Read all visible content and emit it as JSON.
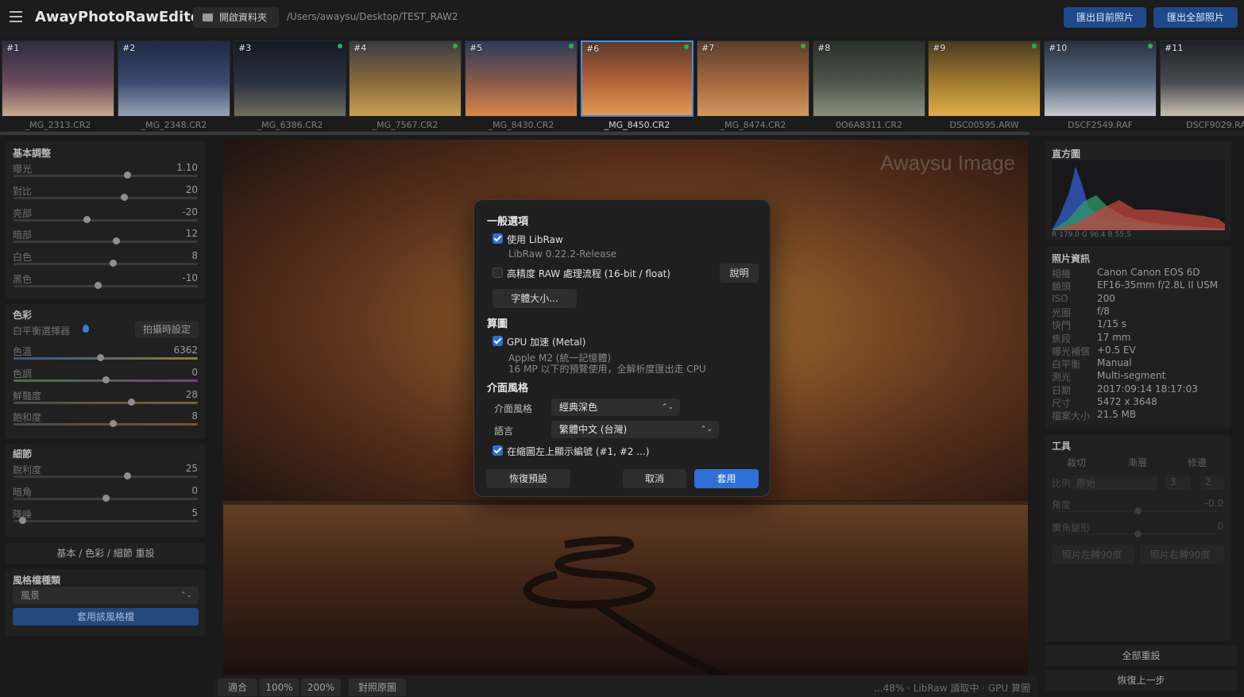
{
  "app": {
    "title": "AwayPhotoRawEditor",
    "open_folder_label": "開啟資料夾",
    "path": "/Users/awaysu/Desktop/TEST_RAW2",
    "export_current_label": "匯出目前照片",
    "export_all_label": "匯出全部照片"
  },
  "filmstrip": [
    {
      "num": "#1",
      "name": "_MG_2313.CR2",
      "colors": [
        "#2b2d3f",
        "#6b4a5e",
        "#c9a98a"
      ]
    },
    {
      "num": "#2",
      "name": "_MG_2348.CR2",
      "colors": [
        "#1e2a44",
        "#3a4a6e",
        "#9aa3b5"
      ]
    },
    {
      "num": "#3",
      "name": "_MG_6386.CR2",
      "colors": [
        "#141a24",
        "#2a3140",
        "#6f6d60"
      ]
    },
    {
      "num": "#4",
      "name": "_MG_7567.CR2",
      "colors": [
        "#3a3b3f",
        "#8a6a3e",
        "#c7a055"
      ]
    },
    {
      "num": "#5",
      "name": "_MG_8430.CR2",
      "colors": [
        "#2e3a5a",
        "#8a5a4a",
        "#d9874a"
      ]
    },
    {
      "num": "#6",
      "name": "_MG_8450.CR2",
      "colors": [
        "#5a3a2a",
        "#b4643a",
        "#e29a52"
      ]
    },
    {
      "num": "#7",
      "name": "_MG_8474.CR2",
      "colors": [
        "#5a3e2e",
        "#a3683e",
        "#cf9a62"
      ]
    },
    {
      "num": "#8",
      "name": "0O6A8311.CR2",
      "colors": [
        "#2a2f2a",
        "#4d564a",
        "#8a8f80"
      ]
    },
    {
      "num": "#9",
      "name": "DSC00595.ARW",
      "colors": [
        "#4a3a1e",
        "#a07a2e",
        "#e0b04a"
      ]
    },
    {
      "num": "#10",
      "name": "DSCF2549.RAF",
      "colors": [
        "#2a3040",
        "#5a6a80",
        "#c7c9d0"
      ]
    },
    {
      "num": "#11",
      "name": "DSCF9029.RA",
      "colors": [
        "#1e2028",
        "#4a4a52",
        "#c9c0b0"
      ]
    }
  ],
  "left_panel": {
    "basic": {
      "title": "基本調整",
      "sliders": [
        {
          "label": "曝光",
          "value": "1.10",
          "pos": 0.62
        },
        {
          "label": "對比",
          "value": "20",
          "pos": 0.6
        },
        {
          "label": "亮部",
          "value": "-20",
          "pos": 0.4
        },
        {
          "label": "暗部",
          "value": "12",
          "pos": 0.56
        },
        {
          "label": "白色",
          "value": "8",
          "pos": 0.54
        },
        {
          "label": "黑色",
          "value": "-10",
          "pos": 0.46
        }
      ]
    },
    "color": {
      "title": "色彩",
      "wb_label": "白平衡選擇器",
      "as_shot_label": "拍攝時設定",
      "sliders": [
        {
          "label": "色溫",
          "value": "6362",
          "pos": 0.47
        },
        {
          "label": "色調",
          "value": "0",
          "pos": 0.5
        },
        {
          "label": "鮮豔度",
          "value": "28",
          "pos": 0.64
        },
        {
          "label": "飽和度",
          "value": "8",
          "pos": 0.54
        }
      ]
    },
    "detail": {
      "title": "細節",
      "sliders": [
        {
          "label": "銳利度",
          "value": "25",
          "pos": 0.62
        },
        {
          "label": "暗角",
          "value": "0",
          "pos": 0.5
        },
        {
          "label": "降噪",
          "value": "5",
          "pos": 0.05
        }
      ]
    },
    "reset_label": "基本 / 色彩 / 細節 重設",
    "style": {
      "title": "風格檔種類",
      "selected": "風景",
      "apply_label": "套用該風格檔"
    }
  },
  "image": {
    "watermark": "Awaysu Image"
  },
  "bottom": {
    "fit": "適合",
    "z100": "100%",
    "z200": "200%",
    "compare": "對照原圖",
    "status": "...48% · LibRaw 讀取中 · GPU 算圖"
  },
  "right_panel": {
    "histogram": {
      "title": "直方圖",
      "values": "R 179.0 G 96.4 B 55.5"
    },
    "info": {
      "title": "照片資訊",
      "rows": [
        {
          "k": "相機",
          "v": "Canon Canon EOS 6D"
        },
        {
          "k": "鏡頭",
          "v": "EF16-35mm f/2.8L II USM"
        },
        {
          "k": "ISO",
          "v": "200"
        },
        {
          "k": "光圈",
          "v": "f/8"
        },
        {
          "k": "快門",
          "v": "1/15 s"
        },
        {
          "k": "焦段",
          "v": "17 mm"
        },
        {
          "k": "曝光補償",
          "v": "+0.5 EV"
        },
        {
          "k": "白平衡",
          "v": "Manual"
        },
        {
          "k": "測光",
          "v": "Multi-segment"
        },
        {
          "k": "日期",
          "v": "2017:09:14 18:17:03"
        },
        {
          "k": "尺寸",
          "v": "5472 x 3648"
        },
        {
          "k": "檔案大小",
          "v": "21.5 MB"
        }
      ]
    },
    "tools": {
      "title": "工具",
      "tab_crop": "裁切",
      "tab_gradient": "漸層",
      "tab_retouch": "修邊",
      "ratio_label": "比例",
      "ratio_value": "原始",
      "ratio_w": "3",
      "ratio_h": "2",
      "angle_label": "角度",
      "angle_value": "-0.0",
      "lens_label": "廣角變形",
      "lens_value": "0",
      "rotate_left": "照片左轉90度",
      "rotate_right": "照片右轉90度"
    },
    "reset_all": "全部重設",
    "undo": "恢復上一步"
  },
  "dialog": {
    "general_title": "一般選項",
    "use_libraw": "使用 LibRaw",
    "libraw_version": "LibRaw 0.22.2-Release",
    "hp_raw": "高精度 RAW 處理流程 (16-bit / float)",
    "help_label": "說明",
    "font_size_label": "字體大小...",
    "render_title": "算圖",
    "gpu_label": "GPU 加速 (Metal)",
    "gpu_device": "Apple M2 (統一記憶體)",
    "gpu_note": "16 MP 以下的預覽使用，全解析度匯出走 CPU",
    "ui_title": "介面風格",
    "style_label": "介面風格",
    "style_value": "經典深色",
    "lang_label": "語言",
    "lang_value": "繁體中文 (台灣)",
    "show_num": "在縮圖左上顯示編號 (#1, #2 ...)",
    "restore_label": "恢復預設",
    "cancel_label": "取消",
    "apply_label": "套用"
  },
  "colors": {
    "accent": "#2f6fd6",
    "top_button": "#1f4a8a"
  }
}
